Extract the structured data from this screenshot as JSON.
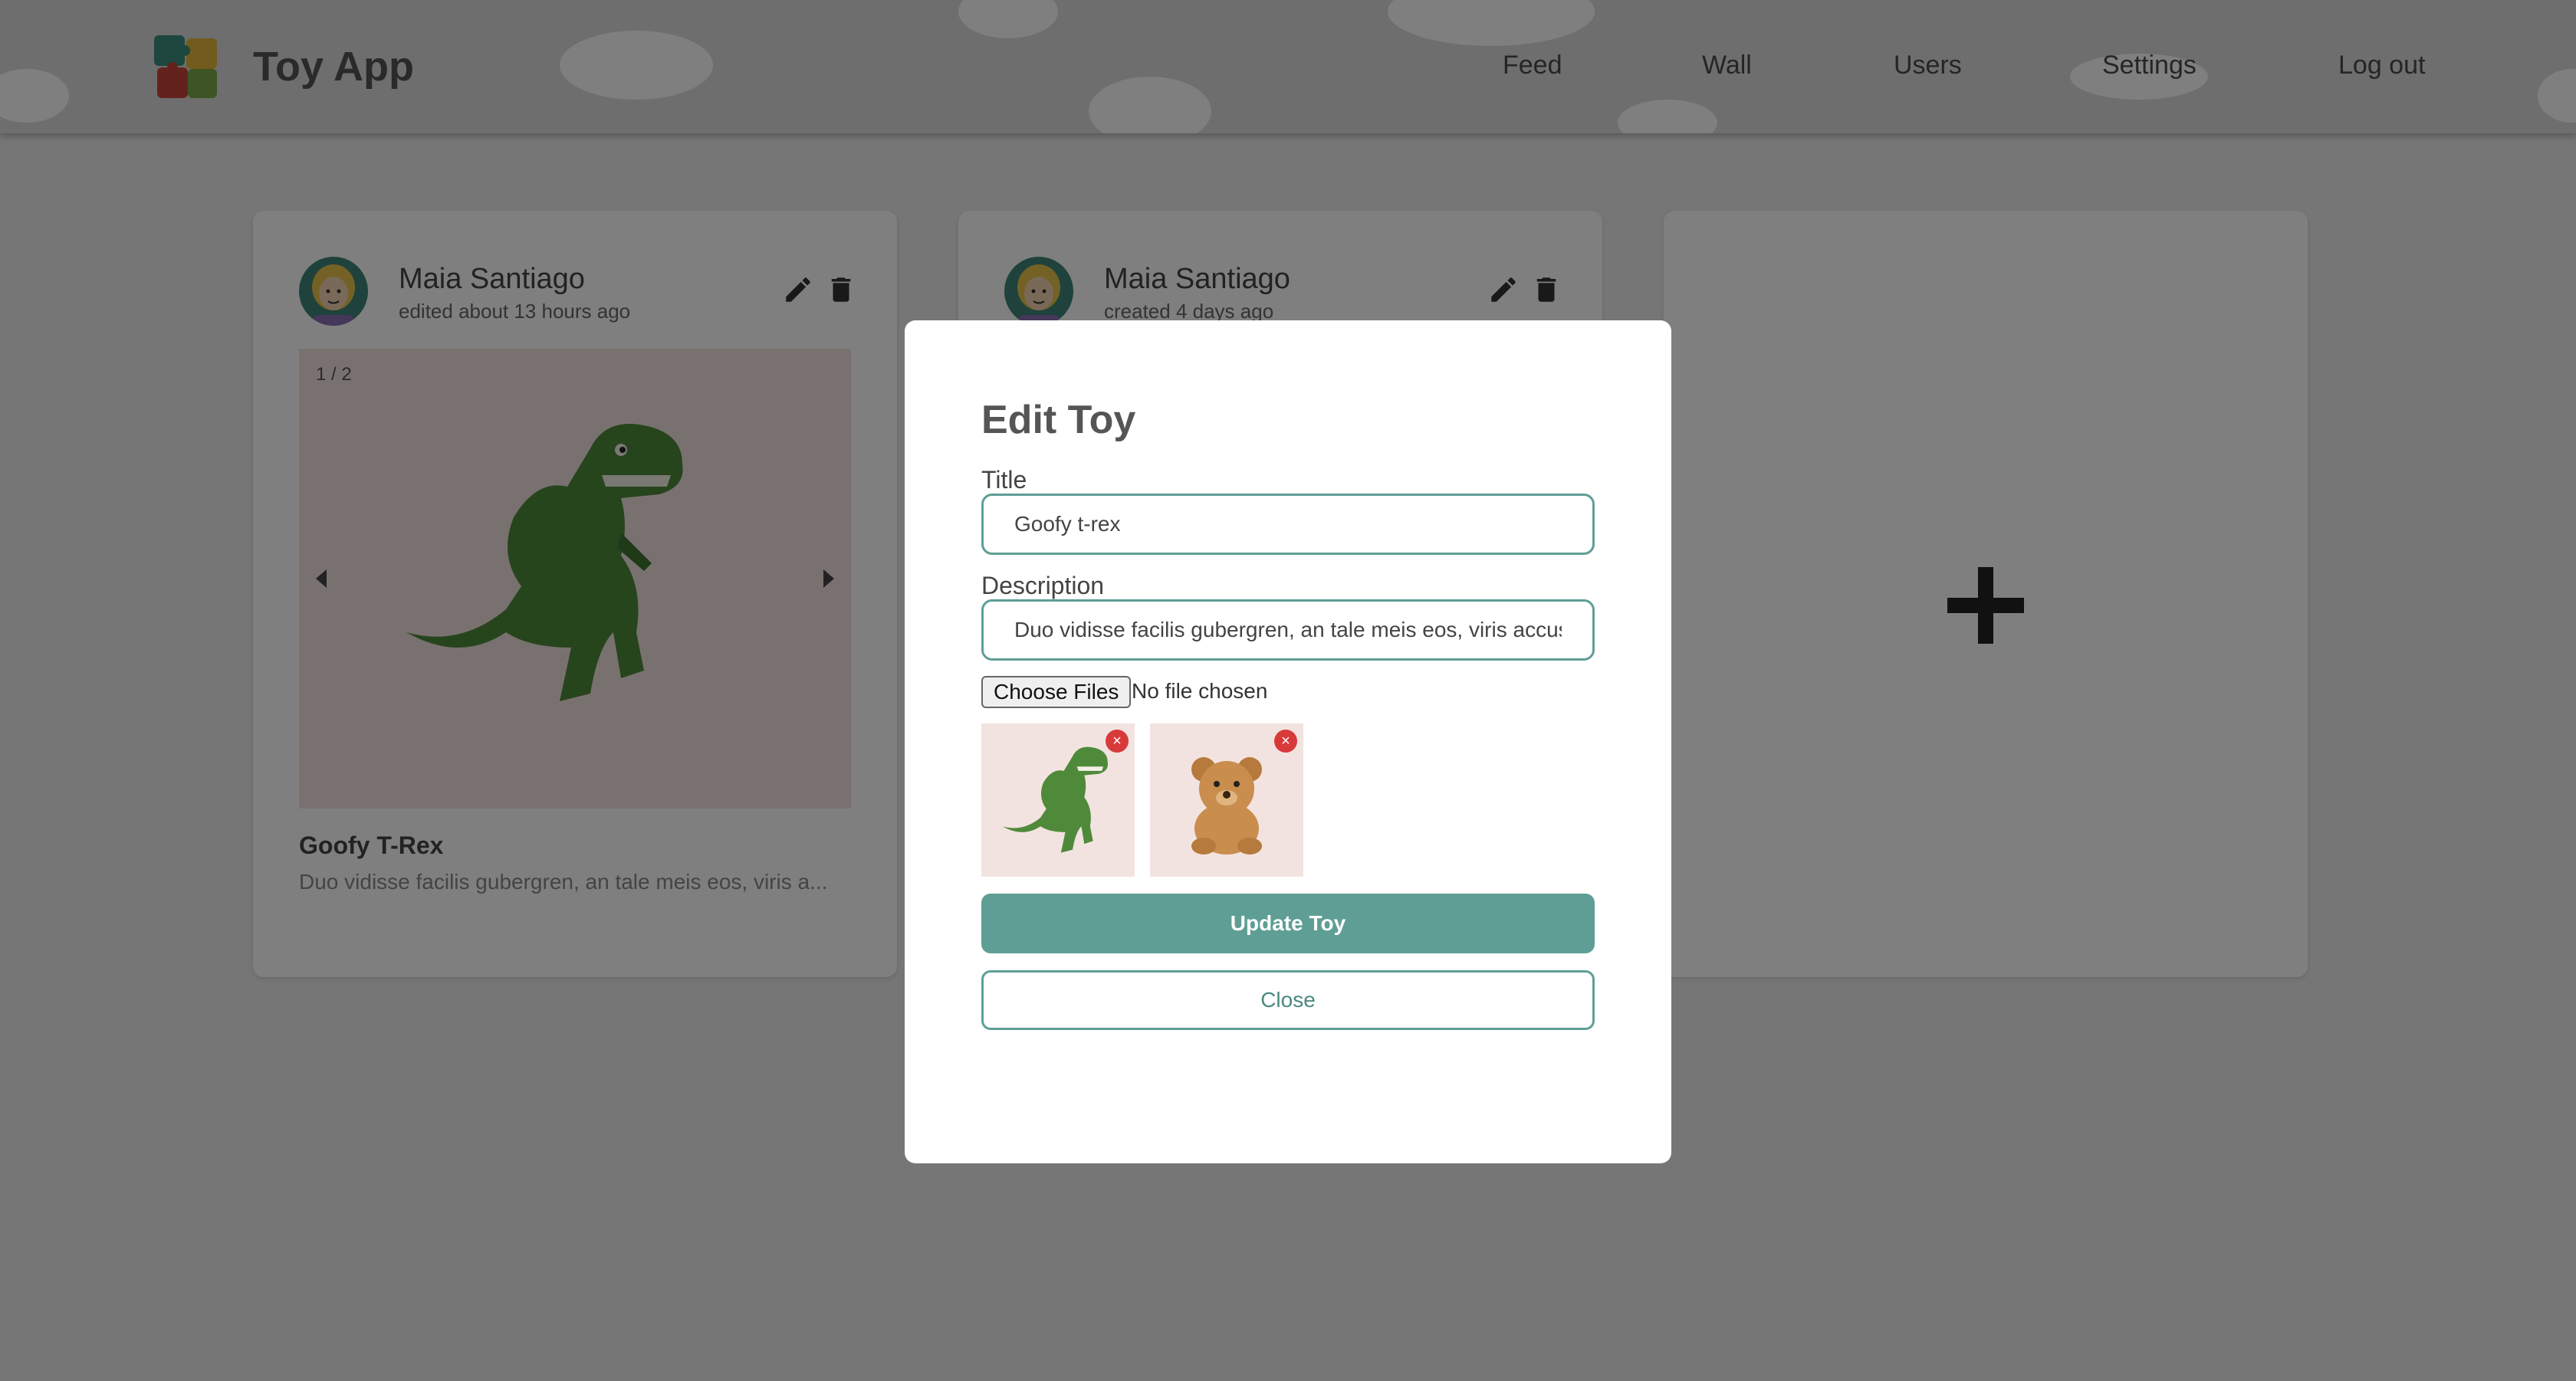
{
  "navbar": {
    "brand": "Toy App",
    "links": [
      "Feed",
      "Wall",
      "Users",
      "Settings",
      "Log out"
    ]
  },
  "cards": [
    {
      "author": "Maia Santiago",
      "meta": "edited about 13 hours ago",
      "counter": "1 / 2",
      "title": "Goofy T-Rex",
      "description": "Duo vidisse facilis gubergren, an tale meis eos, viris a..."
    },
    {
      "author": "Maia Santiago",
      "meta": "created 4 days ago"
    }
  ],
  "modal": {
    "title": "Edit Toy",
    "title_label": "Title",
    "title_value": "Goofy t-rex",
    "description_label": "Description",
    "description_value": "Duo vidisse facilis gubergren, an tale meis eos, viris accus",
    "file_button": "Choose Files",
    "file_status": "No file chosen",
    "remove_glyph": "×",
    "submit_label": "Update Toy",
    "close_label": "Close"
  },
  "colors": {
    "accent": "#5e9e95",
    "danger": "#d83a3a",
    "image_bg": "#f3e3e0"
  },
  "icons": [
    "puzzle-logo-icon",
    "pencil-icon",
    "trash-icon",
    "chevron-left-icon",
    "chevron-right-icon",
    "plus-icon",
    "close-icon"
  ]
}
